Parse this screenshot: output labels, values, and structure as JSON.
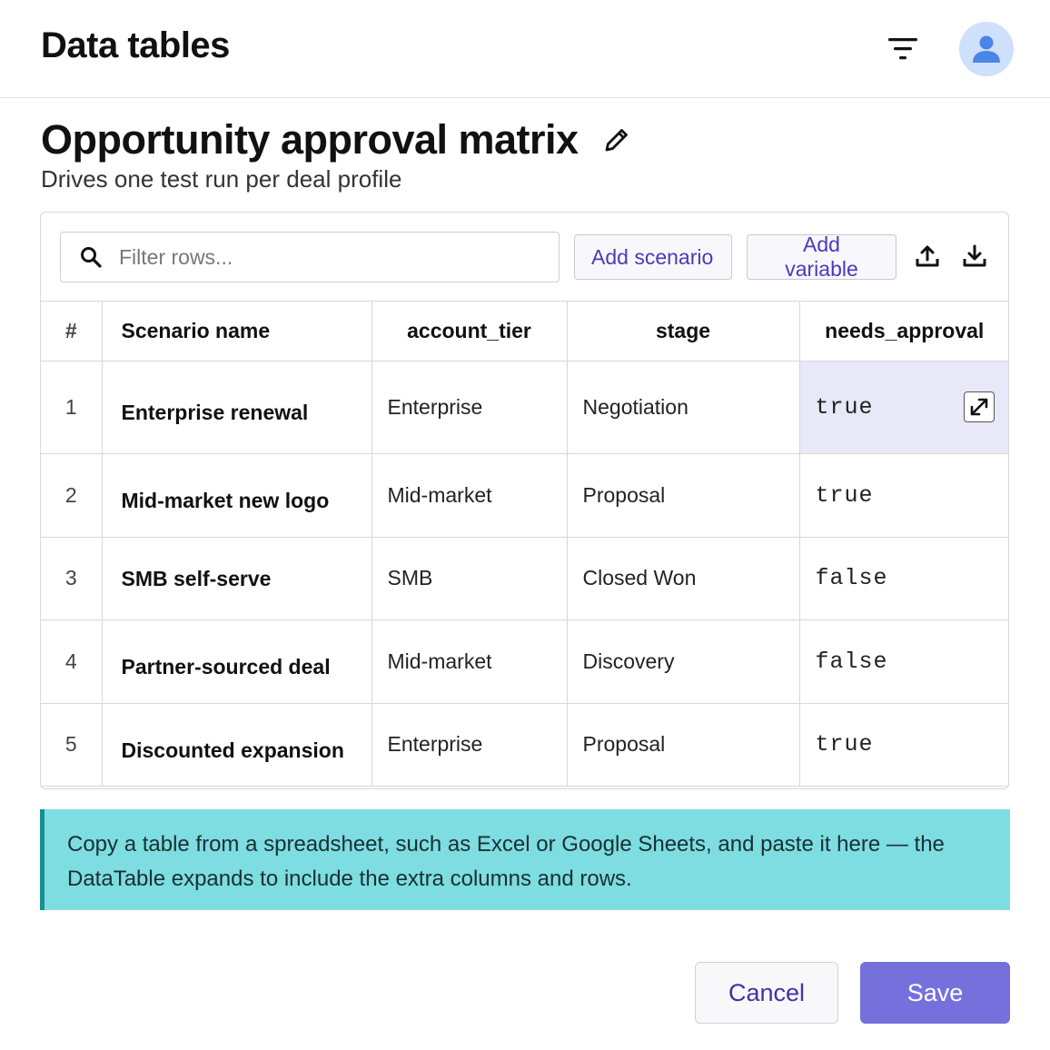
{
  "header": {
    "app_title": "Data tables"
  },
  "page": {
    "title": "Opportunity approval matrix",
    "subtitle": "Drives one test run per deal profile"
  },
  "toolbar": {
    "search_placeholder": "Filter rows...",
    "add_scenario": "Add scenario",
    "add_variable": "Add variable"
  },
  "table": {
    "columns": [
      "#",
      "Scenario name",
      "account_tier",
      "stage",
      "needs_approval"
    ],
    "rows": [
      {
        "num": "1",
        "name": "Enterprise renewal",
        "account_tier": "Enterprise",
        "stage": "Negotiation",
        "needs_approval": "true"
      },
      {
        "num": "2",
        "name": "Mid-market new logo",
        "account_tier": "Mid-market",
        "stage": "Proposal",
        "needs_approval": "true"
      },
      {
        "num": "3",
        "name": "SMB self-serve",
        "account_tier": "SMB",
        "stage": "Closed Won",
        "needs_approval": "false"
      },
      {
        "num": "4",
        "name": "Partner-sourced deal",
        "account_tier": "Mid-market",
        "stage": "Discovery",
        "needs_approval": "false"
      },
      {
        "num": "5",
        "name": "Discounted expansion",
        "account_tier": "Enterprise",
        "stage": "Proposal",
        "needs_approval": "true"
      }
    ]
  },
  "tip": {
    "text": "Copy a table from a spreadsheet, such as Excel or Google Sheets, and paste it here — the DataTable expands to include the extra columns and rows."
  },
  "footer": {
    "cancel": "Cancel",
    "save": "Save"
  },
  "colors": {
    "accent": "#7670dd",
    "accent_text": "#4a3bb8",
    "tip_bg": "#7ddde0",
    "tip_border": "#17918f",
    "avatar_bg": "#cfe0fb",
    "avatar_icon": "#4a86e8",
    "selected_cell": "#e9e8f8"
  },
  "icons": {
    "filter": "filter-icon",
    "avatar": "user-icon",
    "edit": "pencil-icon",
    "search": "search-icon",
    "upload": "upload-icon",
    "download": "download-icon",
    "expand": "expand-icon"
  }
}
